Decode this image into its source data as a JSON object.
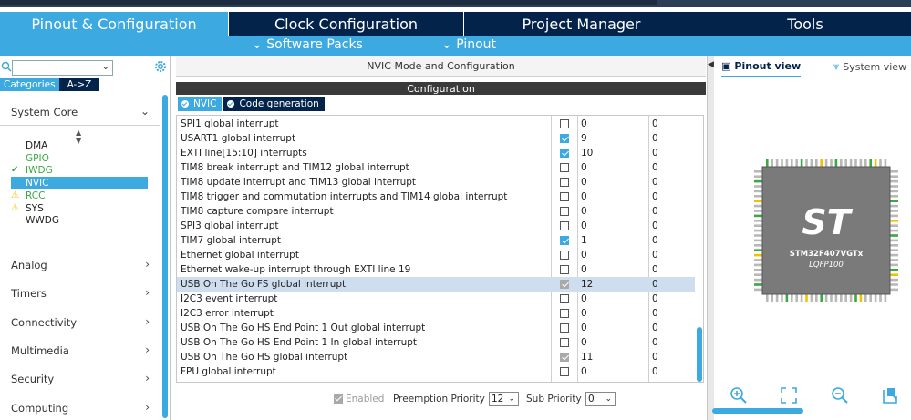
{
  "main_tabs": [
    "Pinout & Configuration",
    "Clock Configuration",
    "Project Manager",
    "Tools"
  ],
  "sub_menu": [
    "Software Packs",
    "Pinout"
  ],
  "left": {
    "category_tabs": [
      "Categories",
      "A->Z"
    ],
    "system_core": {
      "label": "System Core",
      "items": [
        {
          "label": "DMA",
          "status": "none",
          "color": "#333333"
        },
        {
          "label": "GPIO",
          "status": "none",
          "color": "#3aa843"
        },
        {
          "label": "IWDG",
          "status": "check",
          "color": "#3aa843"
        },
        {
          "label": "NVIC",
          "status": "selected",
          "color": "#ffffff"
        },
        {
          "label": "RCC",
          "status": "warning",
          "color": "#3aa843"
        },
        {
          "label": "SYS",
          "status": "warning",
          "color": "#333333"
        },
        {
          "label": "WWDG",
          "status": "none",
          "color": "#333333"
        }
      ]
    },
    "sections": [
      "Analog",
      "Timers",
      "Connectivity",
      "Multimedia",
      "Security",
      "Computing"
    ]
  },
  "middle": {
    "header": "NVIC Mode and Configuration",
    "config_bar": "Configuration",
    "tabs": [
      "NVIC",
      "Code generation"
    ],
    "rows": [
      {
        "name": "SPI1 global interrupt",
        "enabled": "off",
        "preemption": "0",
        "sub": "0"
      },
      {
        "name": "USART1 global interrupt",
        "enabled": "on",
        "preemption": "9",
        "sub": "0"
      },
      {
        "name": "EXTI line[15:10] interrupts",
        "enabled": "on",
        "preemption": "10",
        "sub": "0"
      },
      {
        "name": "TIM8 break interrupt and TIM12 global interrupt",
        "enabled": "off",
        "preemption": "0",
        "sub": "0"
      },
      {
        "name": "TIM8 update interrupt and TIM13 global interrupt",
        "enabled": "off",
        "preemption": "0",
        "sub": "0"
      },
      {
        "name": "TIM8 trigger and commutation interrupts and TIM14 global interrupt",
        "enabled": "off",
        "preemption": "0",
        "sub": "0"
      },
      {
        "name": "TIM8 capture compare interrupt",
        "enabled": "off",
        "preemption": "0",
        "sub": "0"
      },
      {
        "name": "SPI3 global interrupt",
        "enabled": "off",
        "preemption": "0",
        "sub": "0"
      },
      {
        "name": "TIM7 global interrupt",
        "enabled": "on",
        "preemption": "1",
        "sub": "0"
      },
      {
        "name": "Ethernet global interrupt",
        "enabled": "off",
        "preemption": "0",
        "sub": "0"
      },
      {
        "name": "Ethernet wake-up interrupt through EXTI line 19",
        "enabled": "off",
        "preemption": "0",
        "sub": "0"
      },
      {
        "name": "USB On The Go FS global interrupt",
        "enabled": "disabled",
        "preemption": "12",
        "sub": "0",
        "selected": true
      },
      {
        "name": "I2C3 event interrupt",
        "enabled": "off",
        "preemption": "0",
        "sub": "0"
      },
      {
        "name": "I2C3 error interrupt",
        "enabled": "off",
        "preemption": "0",
        "sub": "0"
      },
      {
        "name": "USB On The Go HS End Point 1 Out global interrupt",
        "enabled": "off",
        "preemption": "0",
        "sub": "0"
      },
      {
        "name": "USB On The Go HS End Point 1 In global interrupt",
        "enabled": "off",
        "preemption": "0",
        "sub": "0"
      },
      {
        "name": "USB On The Go HS global interrupt",
        "enabled": "disabled",
        "preemption": "11",
        "sub": "0"
      },
      {
        "name": "FPU global interrupt",
        "enabled": "off",
        "preemption": "0",
        "sub": "0"
      }
    ],
    "bottom": {
      "enabled_label": "Enabled",
      "preemption_label": "Preemption Priority",
      "preemption_value": "12",
      "sub_label": "Sub Priority",
      "sub_value": "0"
    }
  },
  "right": {
    "tabs": [
      "Pinout view",
      "System view"
    ],
    "chip_name": "STM32F407VGTx",
    "chip_package": "LQFP100",
    "logo": "ST"
  },
  "colors": {
    "accent": "#3ca9e0",
    "navy": "#03234b",
    "green": "#3aa843",
    "warning": "#f2c200"
  }
}
